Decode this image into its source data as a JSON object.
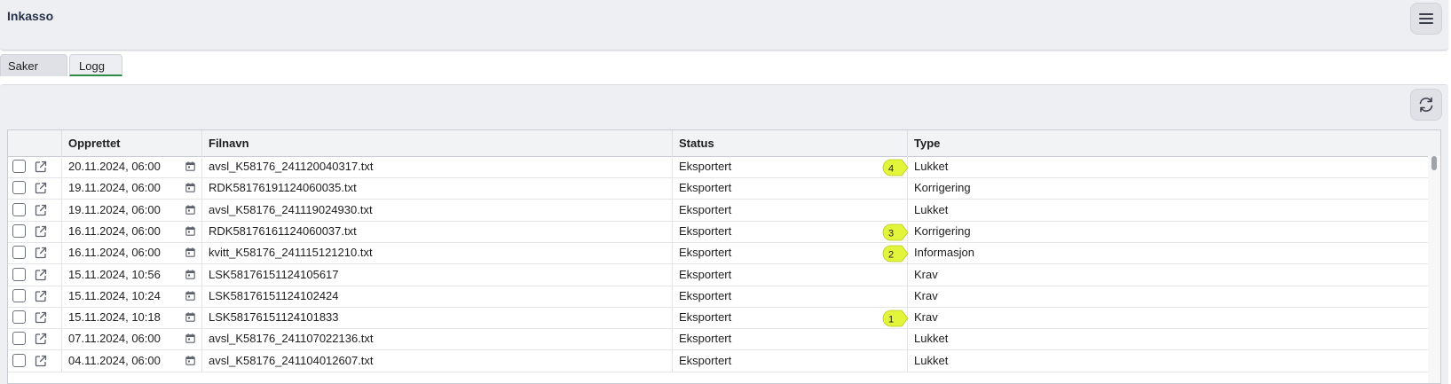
{
  "app": {
    "title": "Inkasso"
  },
  "tabs": [
    {
      "label": "Saker",
      "active": false
    },
    {
      "label": "Logg",
      "active": true
    }
  ],
  "icons": {
    "menu": "hamburger-menu-icon",
    "refresh": "refresh-icon",
    "open": "external-link-icon",
    "calendar": "calendar-icon"
  },
  "colors": {
    "active_tab_underline": "#2e8a47",
    "badge": "#e3f53a"
  },
  "table": {
    "columns": [
      "Opprettet",
      "Filnavn",
      "Status",
      "Type"
    ],
    "rows": [
      {
        "opprettet": "20.11.2024, 06:00",
        "filnavn": "avsl_K58176_241120040317.txt",
        "status": "Eksportert",
        "type": "Lukket",
        "badge": "4"
      },
      {
        "opprettet": "19.11.2024, 06:00",
        "filnavn": "RDK58176191124060035.txt",
        "status": "Eksportert",
        "type": "Korrigering",
        "badge": ""
      },
      {
        "opprettet": "19.11.2024, 06:00",
        "filnavn": "avsl_K58176_241119024930.txt",
        "status": "Eksportert",
        "type": "Lukket",
        "badge": ""
      },
      {
        "opprettet": "16.11.2024, 06:00",
        "filnavn": "RDK58176161124060037.txt",
        "status": "Eksportert",
        "type": "Korrigering",
        "badge": "3"
      },
      {
        "opprettet": "16.11.2024, 06:00",
        "filnavn": "kvitt_K58176_241115121210.txt",
        "status": "Eksportert",
        "type": "Informasjon",
        "badge": "2"
      },
      {
        "opprettet": "15.11.2024, 10:56",
        "filnavn": "LSK58176151124105617",
        "status": "Eksportert",
        "type": "Krav",
        "badge": ""
      },
      {
        "opprettet": "15.11.2024, 10:24",
        "filnavn": "LSK58176151124102424",
        "status": "Eksportert",
        "type": "Krav",
        "badge": ""
      },
      {
        "opprettet": "15.11.2024, 10:18",
        "filnavn": "LSK58176151124101833",
        "status": "Eksportert",
        "type": "Krav",
        "badge": "1"
      },
      {
        "opprettet": "07.11.2024, 06:00",
        "filnavn": "avsl_K58176_241107022136.txt",
        "status": "Eksportert",
        "type": "Lukket",
        "badge": ""
      },
      {
        "opprettet": "04.11.2024, 06:00",
        "filnavn": "avsl_K58176_241104012607.txt",
        "status": "Eksportert",
        "type": "Lukket",
        "badge": ""
      }
    ]
  }
}
